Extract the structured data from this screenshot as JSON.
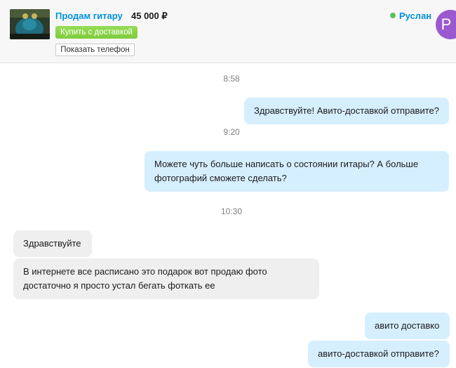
{
  "header": {
    "product_title": "Продам гитару",
    "price": "45 000 ₽",
    "buy_button": "Купить с доставкой",
    "phone_button": "Показать телефон",
    "user_name": "Руслан",
    "user_status": "online",
    "avatar_letter": "Р"
  },
  "colors": {
    "link_blue": "#0091d9",
    "buy_green": "#8ed84f",
    "online_green": "#5ec15a",
    "outgoing_bubble": "#d6efff",
    "incoming_bubble": "#efefef",
    "avatar_purple": "#9b59d0"
  },
  "chat": {
    "times": [
      "8:58",
      "9:20",
      "10:30"
    ],
    "messages": [
      {
        "direction": "out",
        "text": "Здравствуйте! Авито-доставкой отправите?"
      },
      {
        "direction": "out",
        "text": "Можете чуть больше написать о состоянии гитары? А больше фотографий сможете сделать?"
      },
      {
        "direction": "in",
        "text": "Здравствуйте"
      },
      {
        "direction": "in",
        "text": "В интернете все расписано это подарок вот продаю фото достаточно я просто устал бегать фоткать ее"
      },
      {
        "direction": "out",
        "text": "авито доставко"
      },
      {
        "direction": "out",
        "text": "авито-доставкой отправите?"
      }
    ]
  }
}
